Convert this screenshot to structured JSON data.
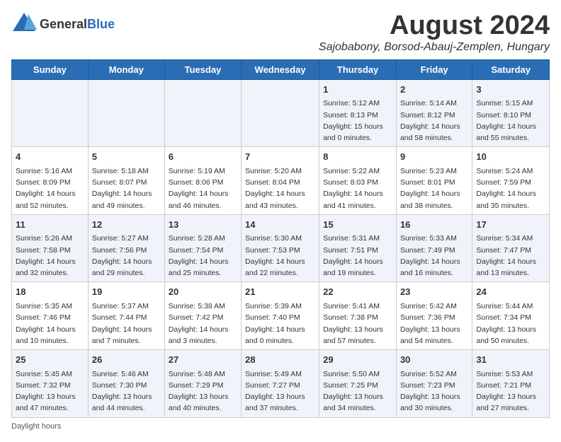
{
  "header": {
    "logo_general": "General",
    "logo_blue": "Blue",
    "month_year": "August 2024",
    "location": "Sajobabony, Borsod-Abauj-Zemplen, Hungary"
  },
  "days_of_week": [
    "Sunday",
    "Monday",
    "Tuesday",
    "Wednesday",
    "Thursday",
    "Friday",
    "Saturday"
  ],
  "weeks": [
    [
      {
        "day": "",
        "info": ""
      },
      {
        "day": "",
        "info": ""
      },
      {
        "day": "",
        "info": ""
      },
      {
        "day": "",
        "info": ""
      },
      {
        "day": "1",
        "info": "Sunrise: 5:12 AM\nSunset: 8:13 PM\nDaylight: 15 hours\nand 0 minutes."
      },
      {
        "day": "2",
        "info": "Sunrise: 5:14 AM\nSunset: 8:12 PM\nDaylight: 14 hours\nand 58 minutes."
      },
      {
        "day": "3",
        "info": "Sunrise: 5:15 AM\nSunset: 8:10 PM\nDaylight: 14 hours\nand 55 minutes."
      }
    ],
    [
      {
        "day": "4",
        "info": "Sunrise: 5:16 AM\nSunset: 8:09 PM\nDaylight: 14 hours\nand 52 minutes."
      },
      {
        "day": "5",
        "info": "Sunrise: 5:18 AM\nSunset: 8:07 PM\nDaylight: 14 hours\nand 49 minutes."
      },
      {
        "day": "6",
        "info": "Sunrise: 5:19 AM\nSunset: 8:06 PM\nDaylight: 14 hours\nand 46 minutes."
      },
      {
        "day": "7",
        "info": "Sunrise: 5:20 AM\nSunset: 8:04 PM\nDaylight: 14 hours\nand 43 minutes."
      },
      {
        "day": "8",
        "info": "Sunrise: 5:22 AM\nSunset: 8:03 PM\nDaylight: 14 hours\nand 41 minutes."
      },
      {
        "day": "9",
        "info": "Sunrise: 5:23 AM\nSunset: 8:01 PM\nDaylight: 14 hours\nand 38 minutes."
      },
      {
        "day": "10",
        "info": "Sunrise: 5:24 AM\nSunset: 7:59 PM\nDaylight: 14 hours\nand 35 minutes."
      }
    ],
    [
      {
        "day": "11",
        "info": "Sunrise: 5:26 AM\nSunset: 7:58 PM\nDaylight: 14 hours\nand 32 minutes."
      },
      {
        "day": "12",
        "info": "Sunrise: 5:27 AM\nSunset: 7:56 PM\nDaylight: 14 hours\nand 29 minutes."
      },
      {
        "day": "13",
        "info": "Sunrise: 5:28 AM\nSunset: 7:54 PM\nDaylight: 14 hours\nand 25 minutes."
      },
      {
        "day": "14",
        "info": "Sunrise: 5:30 AM\nSunset: 7:53 PM\nDaylight: 14 hours\nand 22 minutes."
      },
      {
        "day": "15",
        "info": "Sunrise: 5:31 AM\nSunset: 7:51 PM\nDaylight: 14 hours\nand 19 minutes."
      },
      {
        "day": "16",
        "info": "Sunrise: 5:33 AM\nSunset: 7:49 PM\nDaylight: 14 hours\nand 16 minutes."
      },
      {
        "day": "17",
        "info": "Sunrise: 5:34 AM\nSunset: 7:47 PM\nDaylight: 14 hours\nand 13 minutes."
      }
    ],
    [
      {
        "day": "18",
        "info": "Sunrise: 5:35 AM\nSunset: 7:46 PM\nDaylight: 14 hours\nand 10 minutes."
      },
      {
        "day": "19",
        "info": "Sunrise: 5:37 AM\nSunset: 7:44 PM\nDaylight: 14 hours\nand 7 minutes."
      },
      {
        "day": "20",
        "info": "Sunrise: 5:38 AM\nSunset: 7:42 PM\nDaylight: 14 hours\nand 3 minutes."
      },
      {
        "day": "21",
        "info": "Sunrise: 5:39 AM\nSunset: 7:40 PM\nDaylight: 14 hours\nand 0 minutes."
      },
      {
        "day": "22",
        "info": "Sunrise: 5:41 AM\nSunset: 7:38 PM\nDaylight: 13 hours\nand 57 minutes."
      },
      {
        "day": "23",
        "info": "Sunrise: 5:42 AM\nSunset: 7:36 PM\nDaylight: 13 hours\nand 54 minutes."
      },
      {
        "day": "24",
        "info": "Sunrise: 5:44 AM\nSunset: 7:34 PM\nDaylight: 13 hours\nand 50 minutes."
      }
    ],
    [
      {
        "day": "25",
        "info": "Sunrise: 5:45 AM\nSunset: 7:32 PM\nDaylight: 13 hours\nand 47 minutes."
      },
      {
        "day": "26",
        "info": "Sunrise: 5:46 AM\nSunset: 7:30 PM\nDaylight: 13 hours\nand 44 minutes."
      },
      {
        "day": "27",
        "info": "Sunrise: 5:48 AM\nSunset: 7:29 PM\nDaylight: 13 hours\nand 40 minutes."
      },
      {
        "day": "28",
        "info": "Sunrise: 5:49 AM\nSunset: 7:27 PM\nDaylight: 13 hours\nand 37 minutes."
      },
      {
        "day": "29",
        "info": "Sunrise: 5:50 AM\nSunset: 7:25 PM\nDaylight: 13 hours\nand 34 minutes."
      },
      {
        "day": "30",
        "info": "Sunrise: 5:52 AM\nSunset: 7:23 PM\nDaylight: 13 hours\nand 30 minutes."
      },
      {
        "day": "31",
        "info": "Sunrise: 5:53 AM\nSunset: 7:21 PM\nDaylight: 13 hours\nand 27 minutes."
      }
    ]
  ],
  "footer": {
    "note": "Daylight hours"
  }
}
